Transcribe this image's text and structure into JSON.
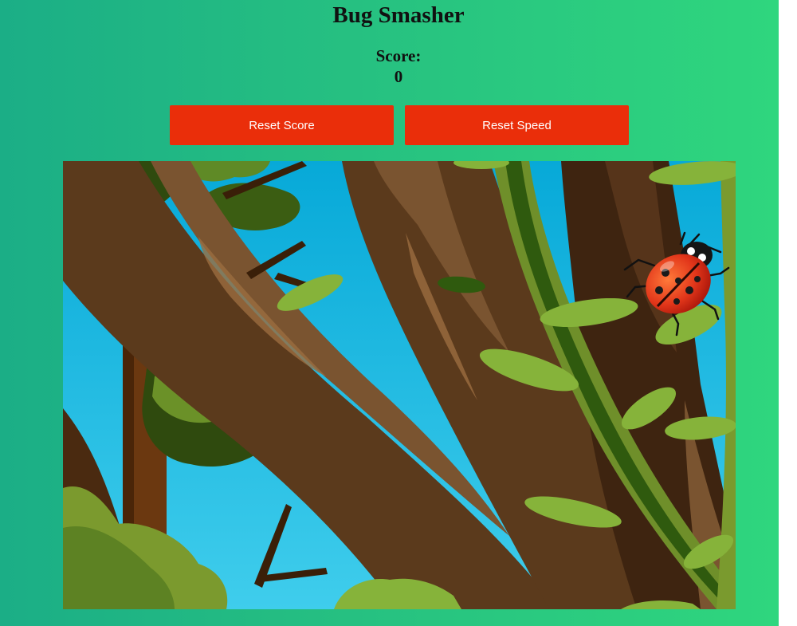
{
  "title": "Bug Smasher",
  "score": {
    "label": "Score:",
    "value": "0"
  },
  "buttons": {
    "reset_score": "Reset Score",
    "reset_speed": "Reset Speed"
  },
  "game": {
    "background": "tree-forest-scene",
    "bug": "ladybug-icon"
  },
  "colors": {
    "page_gradient_start": "#1bae86",
    "page_gradient_end": "#2fd67e",
    "button": "#ea2e0a"
  }
}
